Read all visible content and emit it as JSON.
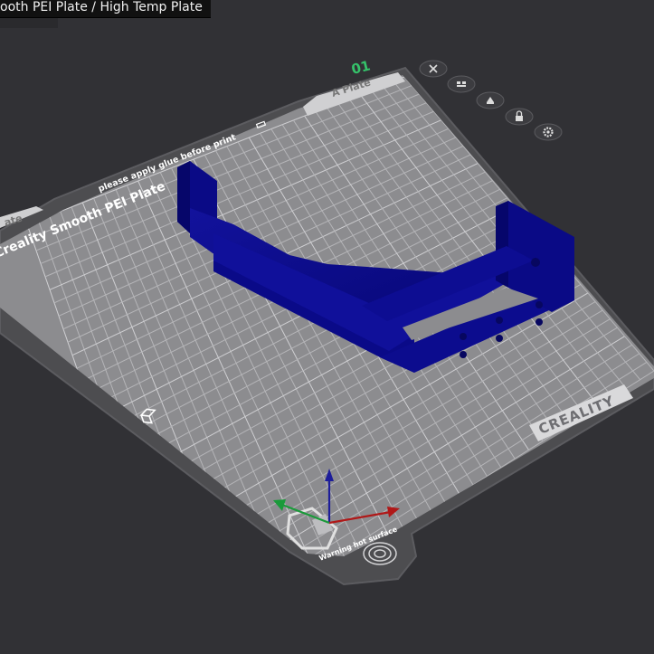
{
  "window": {
    "tooltip_text": "ooth PEI Plate / High Temp Plate"
  },
  "plate": {
    "number": "01",
    "name_label": "A Plate",
    "left_tab_label": "ate",
    "surface_title": "Creality Smooth PEI Plate",
    "glue_notice": "please apply glue before print",
    "brand_label": "CREALITY",
    "warning_text": "Warning hot surface",
    "corner_icon": "plate-corner-icon"
  },
  "toolbar": {
    "items": [
      {
        "name": "close-plate-button",
        "icon": "close-icon"
      },
      {
        "name": "arrange-plate-button",
        "icon": "arrange-icon"
      },
      {
        "name": "orient-plate-button",
        "icon": "orient-icon"
      },
      {
        "name": "lock-plate-button",
        "icon": "lock-icon"
      },
      {
        "name": "plate-settings-button",
        "icon": "gear-icon"
      }
    ]
  },
  "colors": {
    "background": "#313135",
    "plate_surface": "#8e8e90",
    "plate_frame": "#505053",
    "model": "#0b0b8a",
    "plate_number": "#35c26a",
    "axis_x": "#b01818",
    "axis_y": "#1a9a3a",
    "axis_z": "#1d1d9a"
  }
}
